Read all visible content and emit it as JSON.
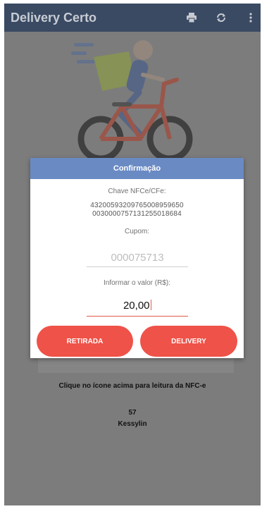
{
  "app": {
    "title": "Delivery Certo"
  },
  "toolbar": {
    "icons": [
      "printer-icon",
      "sync-icon",
      "more-vert-icon"
    ]
  },
  "dialog": {
    "header": "Confirmação",
    "key_label": "Chave NFCe/CFe:",
    "key_line1": "43200593209765008959650",
    "key_line2": "0030000757131255018684",
    "coupon_label": "Cupom:",
    "coupon_placeholder": "000075713",
    "value_label": "Informar o valor (R$):",
    "value": "20,00",
    "button_pickup": "RETIRADA",
    "button_delivery": "DELIVERY"
  },
  "main": {
    "hint": "Clique no ícone acima para leitura da NFC-e",
    "number": "57",
    "user": "Kessylin"
  },
  "colors": {
    "appbar": "#3a4a63",
    "overlay": "#7c7c7c",
    "dialog_header": "#6a8ac4",
    "accent": "#ef5248"
  }
}
